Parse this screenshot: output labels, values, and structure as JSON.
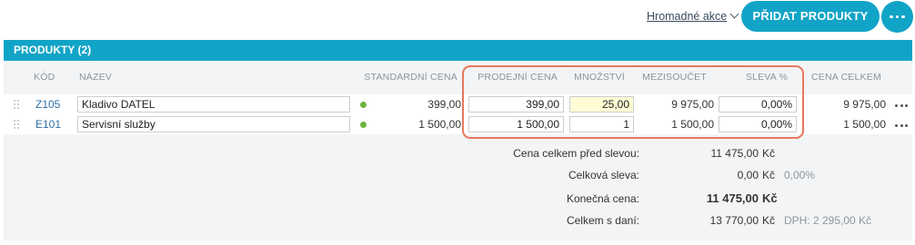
{
  "toolbar": {
    "bulk_actions_label": "Hromadné akce",
    "add_products_label": "PŘIDAT PRODUKTY"
  },
  "panel": {
    "title": "PRODUKTY (2)"
  },
  "columns": {
    "code": "KÓD",
    "name": "NÁZEV",
    "standard_price": "STANDARDNÍ CENA",
    "sale_price": "PRODEJNÍ CENA",
    "quantity": "MNOŽSTVÍ",
    "subtotal": "MEZISOUČET",
    "discount": "SLEVA %",
    "total_price": "CENA CELKEM"
  },
  "rows": [
    {
      "code": "Z105",
      "name": "Kladivo DATEL",
      "standard_price": "399,00",
      "sale_price": "399,00",
      "quantity": "25,00",
      "subtotal": "9 975,00",
      "discount": "0,00%",
      "total_price": "9 975,00"
    },
    {
      "code": "E101",
      "name": "Servisní služby",
      "standard_price": "1 500,00",
      "sale_price": "1 500,00",
      "quantity": "1",
      "subtotal": "1 500,00",
      "discount": "0,00%",
      "total_price": "1 500,00"
    }
  ],
  "summary": {
    "before_discount_label": "Cena celkem před slevou:",
    "before_discount_value": "11 475,00",
    "before_discount_currency": "Kč",
    "total_discount_label": "Celková sleva:",
    "total_discount_value": "0,00",
    "total_discount_currency": "Kč",
    "total_discount_percent": "0,00%",
    "final_price_label": "Konečná cena:",
    "final_price_value": "11 475,00",
    "final_price_currency": "Kč",
    "with_vat_label": "Celkem s daní:",
    "with_vat_value": "13 770,00",
    "with_vat_currency": "Kč",
    "vat_note": "DPH: 2 295,00 Kč"
  },
  "colors": {
    "accent": "#12a4c7",
    "highlight_frame": "#e8775c",
    "status_dot": "#6cb33f",
    "quantity_highlight": "#fffbd4"
  },
  "icons": {
    "bulk_actions": "chevron-down-icon",
    "more": "more-horizontal-icon",
    "drag": "drag-handle-icon",
    "status": "status-dot-icon"
  }
}
